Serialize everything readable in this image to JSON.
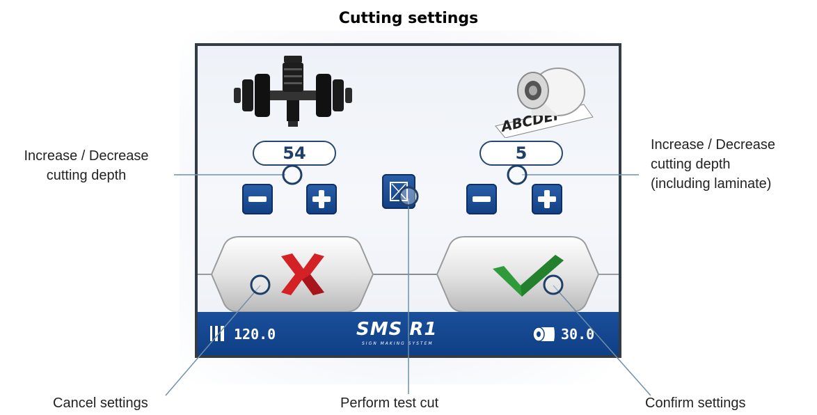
{
  "title": "Cutting settings",
  "panel": {
    "left_value": "54",
    "right_value": "5",
    "status_left_value": "120.0",
    "status_right_value": "30.0",
    "logo": "SMS R1",
    "logo_subtitle": "SIGN MAKING SYSTEM"
  },
  "callouts": {
    "left_depth": [
      "Increase / Decrease",
      "cutting depth"
    ],
    "right_depth": [
      "Increase / Decrease",
      "cutting depth",
      "(including laminate)"
    ],
    "cancel": "Cancel settings",
    "test_cut": "Perform test cut",
    "confirm": "Confirm settings"
  },
  "colors": {
    "button_blue": "#143f83",
    "status_bar_blue": "#124388",
    "cancel_red": "#d42126",
    "confirm_green": "#2f9a3a",
    "callout_line": "#6f8faa"
  },
  "icons": [
    "dumbbell-knife-icon",
    "laminate-roll-icon",
    "minus-icon",
    "plus-icon",
    "test-cut-icon",
    "cancel-x-icon",
    "confirm-check-icon",
    "media-width-icon",
    "roll-length-icon"
  ]
}
